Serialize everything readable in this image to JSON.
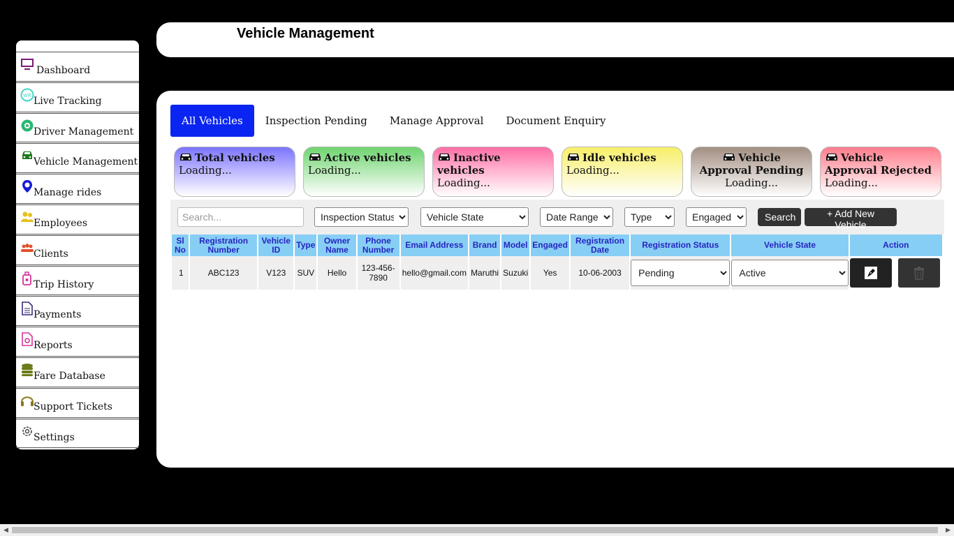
{
  "header": {
    "title": "Vehicle Management"
  },
  "sidebar": {
    "items": [
      {
        "label": "Dashboard",
        "icon": "monitor-icon",
        "color": "#7a1a7a"
      },
      {
        "label": "Live Tracking",
        "icon": "tracking-icon",
        "color": "#45d6c8"
      },
      {
        "label": "Driver Management",
        "icon": "driver-icon",
        "color": "#2bb673"
      },
      {
        "label": "Vehicle Management",
        "icon": "car-icon",
        "color": "#1a7a1a"
      },
      {
        "label": "Manage rides",
        "icon": "location-pin-icon",
        "color": "#1a1ad6"
      },
      {
        "label": "Employees",
        "icon": "employees-icon",
        "color": "#e6c01a"
      },
      {
        "label": "Clients",
        "icon": "clients-icon",
        "color": "#e0502a"
      },
      {
        "label": "Trip History",
        "icon": "luggage-icon",
        "color": "#d6339b"
      },
      {
        "label": "Payments",
        "icon": "document-icon",
        "color": "#3a2a7a"
      },
      {
        "label": "Reports",
        "icon": "report-icon",
        "color": "#d6339b"
      },
      {
        "label": "Fare Database",
        "icon": "database-icon",
        "color": "#6b7a1a"
      },
      {
        "label": "Support Tickets",
        "icon": "headset-icon",
        "color": "#8a7a1a"
      },
      {
        "label": "Settings",
        "icon": "gear-icon",
        "color": "#444"
      }
    ]
  },
  "tabs": [
    "All Vehicles",
    "Inspection Pending",
    "Manage Approval",
    "Document Enquiry"
  ],
  "cards": [
    {
      "title": "Total vehicles",
      "value": "Loading..."
    },
    {
      "title": "Active vehicles",
      "value": "Loading..."
    },
    {
      "title": "Inactive vehicles",
      "value": "Loading..."
    },
    {
      "title": "Idle vehicles",
      "value": "Loading..."
    },
    {
      "title": "Vehicle Approval Pending",
      "value": "Loading..."
    },
    {
      "title": "Vehicle Approval Rejected",
      "value": "Loading..."
    }
  ],
  "filters": {
    "search_placeholder": "Search...",
    "inspection_status": "Inspection Status",
    "vehicle_state": "Vehicle State",
    "date_range": "Date Range",
    "type": "Type",
    "engaged": "Engaged",
    "search_button": "Search",
    "add_button": "+ Add New Vehicle"
  },
  "table": {
    "headers": [
      "Sl No",
      "Registration Number",
      "Vehicle ID",
      "Type",
      "Owner Name",
      "Phone Number",
      "Email Address",
      "Brand",
      "Model",
      "Engaged",
      "Registration Date",
      "Registration Status",
      "Vehicle State",
      "Action"
    ],
    "rows": [
      {
        "sl": "1",
        "reg_no": "ABC123",
        "vehicle_id": "V123",
        "type": "SUV",
        "owner": "Hello",
        "phone": "123-456-7890",
        "email": "hello@gmail.com",
        "brand": "Maruthi",
        "model": "Suzuki",
        "engaged": "Yes",
        "reg_date": "10-06-2003",
        "reg_status": "Pending",
        "vehicle_state": "Active"
      }
    ]
  },
  "colors": {
    "active_tab": "#0a25f2",
    "table_header": "#87cef5",
    "header_text": "#2525c0"
  }
}
